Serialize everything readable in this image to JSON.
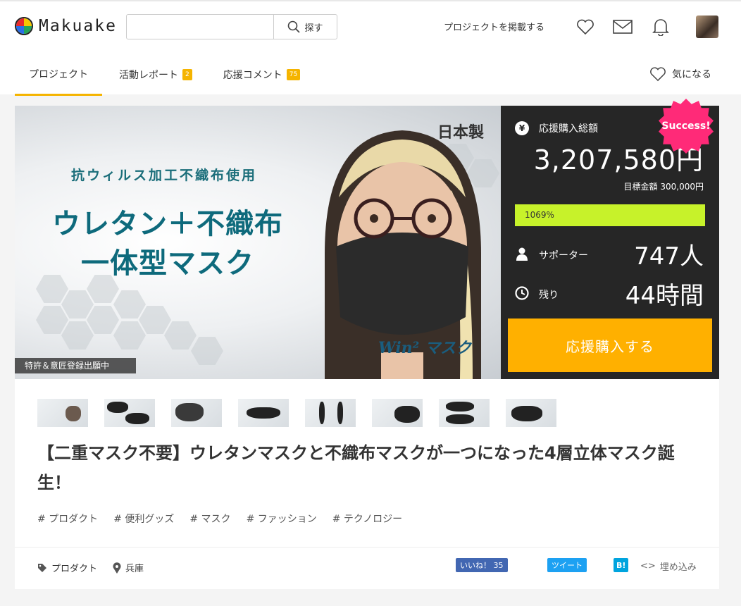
{
  "header": {
    "logo_text": "Makuake",
    "search_placeholder": "",
    "search_button": "探す",
    "post_project": "プロジェクトを掲載する",
    "icons": [
      "heart-icon",
      "mail-icon",
      "bell-icon"
    ]
  },
  "tabs": [
    {
      "label": "プロジェクト",
      "badge": null,
      "active": true
    },
    {
      "label": "活動レポート",
      "badge": "2",
      "active": false
    },
    {
      "label": "応援コメント",
      "badge": "75",
      "active": false
    }
  ],
  "favorite_label": "気になる",
  "hero": {
    "subtitle": "抗ウィルス加工不織布使用",
    "title_line1": "ウレタン＋不織布",
    "title_line2": "一体型マスク",
    "made_in": "日本製",
    "patent": "特許＆意匠登録出願中",
    "logo_text": "Win² マスク"
  },
  "panel": {
    "total_label": "応援購入総額",
    "total_amount": "3,207,580円",
    "goal": "目標金額 300,000円",
    "progress_text": "1069%",
    "progress_fraction": 1.0,
    "supporters_label": "サポーター",
    "supporters_value": "747人",
    "remaining_label": "残り",
    "remaining_value": "44時間",
    "cta": "応援購入する",
    "success_badge": "Success!"
  },
  "thumbnails_count": 8,
  "project": {
    "title": "【二重マスク不要】ウレタンマスクと不織布マスクが一つになった4層立体マスク誕生！",
    "tags": [
      "# プロダクト",
      "# 便利グッズ",
      "# マスク",
      "# ファッション",
      "# テクノロジー"
    ],
    "category": "プロダクト",
    "location": "兵庫"
  },
  "share": {
    "like": "いいね！ 35",
    "tweet": "ツイート",
    "hatena": "B!",
    "embed": "埋め込み"
  },
  "colors": {
    "accent": "#f5b400",
    "cta": "#ffb000",
    "progress": "#c7f22a",
    "success": "#ff2a78",
    "panel": "#262626",
    "facebook": "#4267b2",
    "twitter": "#1da1f2",
    "hatena": "#00a4de"
  }
}
